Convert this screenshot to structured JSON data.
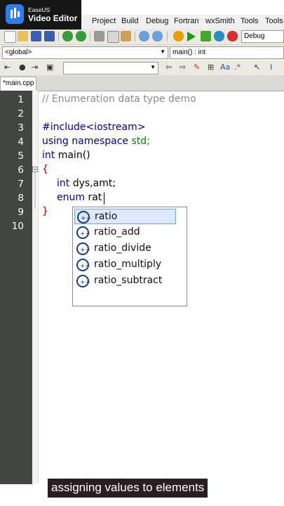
{
  "watermark": {
    "line1": "EaseUS",
    "line2": "Video Editor",
    "icon": "easeus-video-editor-logo"
  },
  "menu": [
    "Project",
    "Build",
    "Debug",
    "Fortran",
    "wxSmith",
    "Tools",
    "Tools+"
  ],
  "toolbar": {
    "build_target": "Debug"
  },
  "scope_bar": {
    "scope": "<global>",
    "symbol": "main() : int"
  },
  "tab": {
    "label": "*main.cpp"
  },
  "line_numbers": [
    "1",
    "2",
    "3",
    "4",
    "5",
    "6",
    "7",
    "8",
    "9",
    "10"
  ],
  "code": {
    "l1": "// Enumeration data type demo",
    "l3": "#include<iostream>",
    "l4_kw": "using namespace",
    "l4_std": "std;",
    "l5_kw": "int",
    "l5_rest": " main()",
    "l6": "{",
    "l7_kw": "int",
    "l7_rest": " dys,amt;",
    "l8_kw": "enum",
    "l8_rest": " rat",
    "l9": "}"
  },
  "autocomplete": {
    "icon": "cpp-class-icon",
    "items": [
      "ratio",
      "ratio_add",
      "ratio_divide",
      "ratio_multiply",
      "ratio_subtract"
    ],
    "selected": "ratio"
  },
  "caption": "assigning values to elements",
  "colors": {
    "gutter": "#404841",
    "comment": "#8c8c8c",
    "keyword": "#00008b",
    "std": "#0b7a0b",
    "brace": "#b00000",
    "selection": "#dce8fb"
  }
}
